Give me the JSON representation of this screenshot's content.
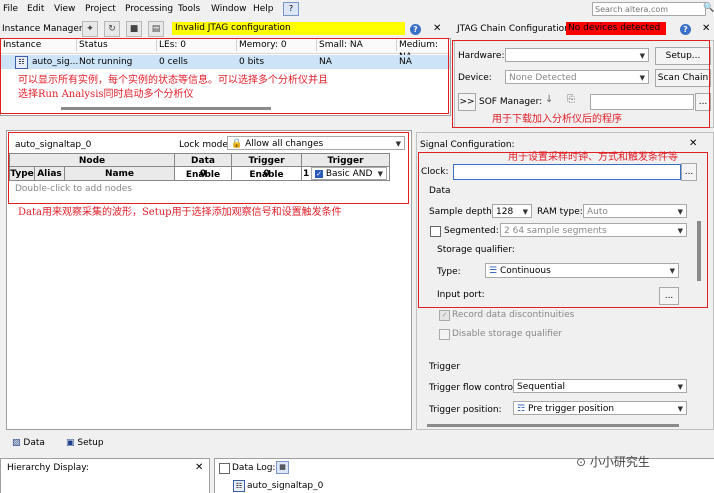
{
  "menu": [
    "File",
    "Edit",
    "View",
    "Project",
    "Processing",
    "Tools",
    "Window",
    "Help"
  ],
  "search_placeholder": "Search altera.com",
  "instance_manager": {
    "label": "Instance Manager:",
    "status": "Invalid JTAG configuration",
    "columns": [
      "Instance",
      "Status",
      "LEs: 0",
      "Memory: 0",
      "Small: NA",
      "Medium: NA"
    ],
    "row": [
      "auto_sig...",
      "Not running",
      "0 cells",
      "0 bits",
      "NA",
      "NA"
    ]
  },
  "jtag": {
    "label": "JTAG Chain Configuration:",
    "status": "No devices detected",
    "hardware_label": "Hardware:",
    "setup_button": "Setup...",
    "device_label": "Device:",
    "device_value": "None Detected",
    "scan_button": "Scan Chain",
    "expand_button": ">>",
    "sof_label": "SOF Manager:",
    "browse_button": "..."
  },
  "annotations": {
    "a1_line1": "可以显示所有实例，每个实例的状态等信息。可以选择多个分析仪并且",
    "a1_line2": "选择Run Analysis同时启动多个分析仪",
    "a2": "用于下载加入分析仪后的程序",
    "a3": "用于设置采样时钟、方式和触发条件等",
    "a4": "Data用来观察采集的波形，Setup用于选择添加观察信号和设置触发条件"
  },
  "setup": {
    "instance_name": "auto_signaltap_0",
    "lock_mode_label": "Lock mode:",
    "lock_mode_value": "Allow all changes",
    "headers": [
      "Node",
      "Data Enable",
      "Trigger Enable",
      "Trigger Conditions"
    ],
    "subheaders": [
      "Type",
      "Alias",
      "Name"
    ],
    "data_enable": "0",
    "trigger_enable": "0",
    "trigger_index": "1",
    "trigger_value": "Basic AND",
    "hint": "Double-click to add nodes"
  },
  "signal_config": {
    "title": "Signal Configuration:",
    "clock_label": "Clock:",
    "clock_browse": "...",
    "data_group": "Data",
    "sample_depth_label": "Sample depth:",
    "sample_depth_value": "128",
    "ram_type_label": "RAM type:",
    "ram_type_value": "Auto",
    "segmented_label": "Segmented:",
    "segmented_value": "2  64 sample segments",
    "storage_qualifier_group": "Storage qualifier:",
    "type_label": "Type:",
    "type_value": "Continuous",
    "input_port_label": "Input port:",
    "input_port_browse": "...",
    "record_label": "Record data discontinuities",
    "disable_label": "Disable storage qualifier",
    "trigger_group": "Trigger",
    "trigger_flow_label": "Trigger flow control:",
    "trigger_flow_value": "Sequential",
    "trigger_position_label": "Trigger position:",
    "trigger_position_value": "Pre trigger position"
  },
  "tabs": [
    "Data",
    "Setup"
  ],
  "hierarchy_label": "Hierarchy Display:",
  "data_log_label": "Data Log:",
  "data_log_item": "auto_signaltap_0",
  "watermark": "小小研究生",
  "colors": {
    "status_yellow": "#ffff00",
    "status_red": "#ff0000",
    "annotation_red": "#e0202a",
    "selection": "#cde3f7"
  }
}
